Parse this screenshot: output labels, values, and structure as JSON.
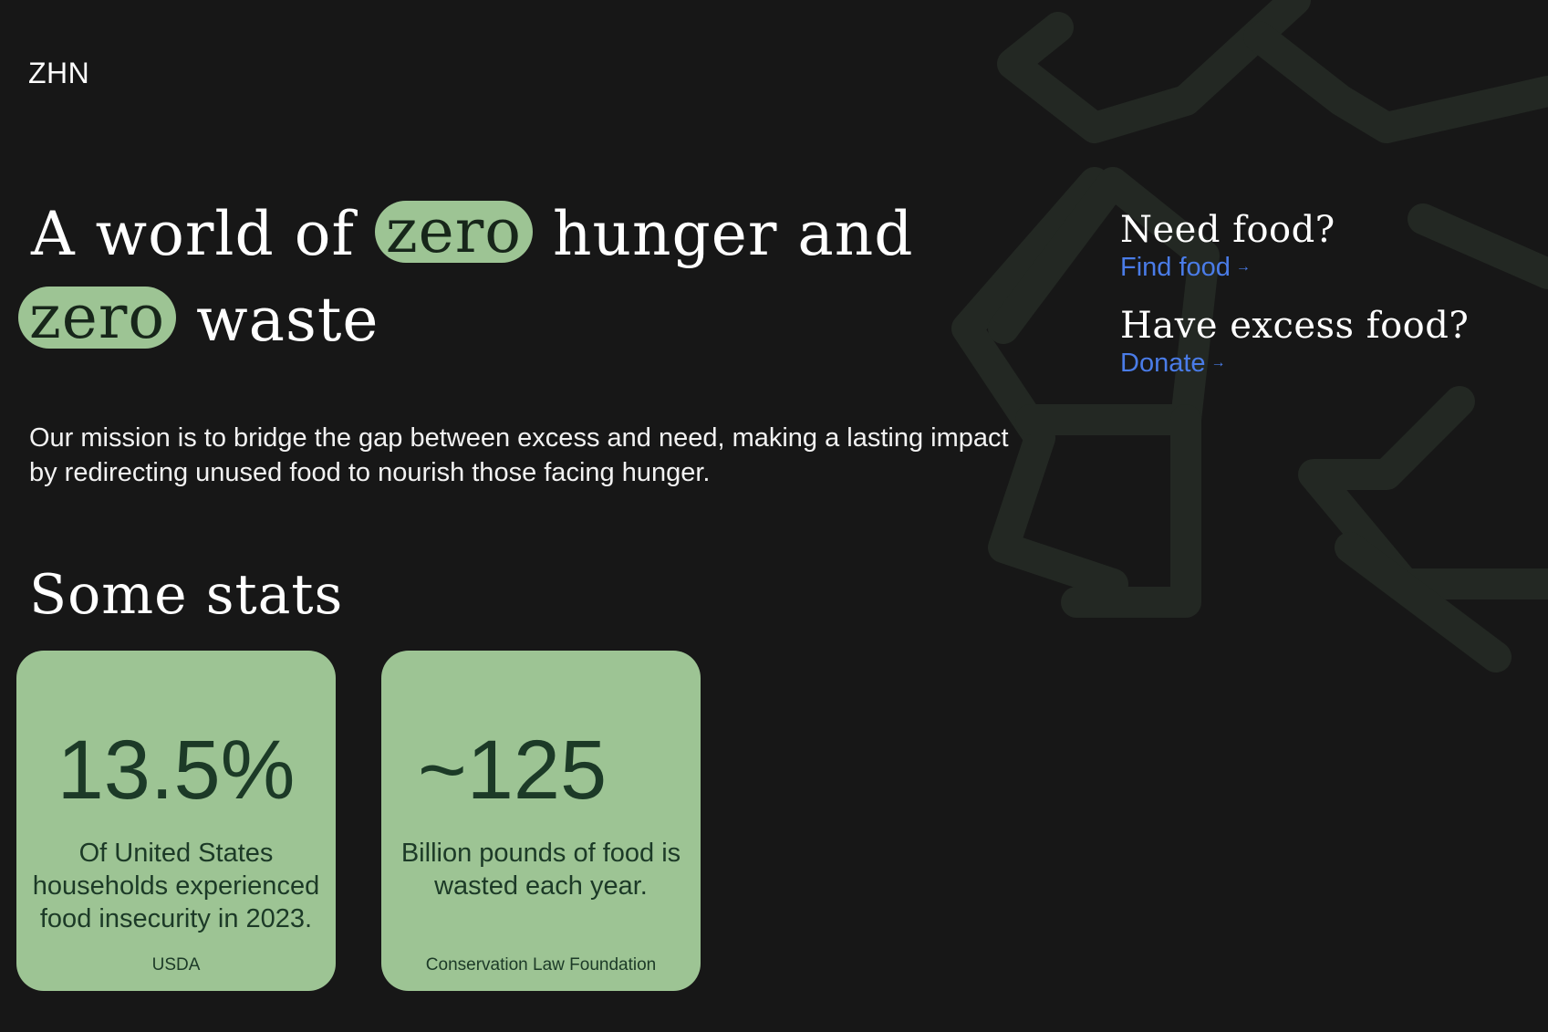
{
  "brand": {
    "logo": "ZHN"
  },
  "hero": {
    "pre": "A world of",
    "highlight1": "zero",
    "mid": "hunger and",
    "highlight2": "zero",
    "post": "waste"
  },
  "mission": "Our mission is to bridge the gap between excess and need, making a lasting impact by redirecting unused food to nourish those facing hunger.",
  "stats": {
    "title": "Some stats",
    "cards": [
      {
        "value": "13.5%",
        "description": "Of United States households experienced food insecurity in 2023.",
        "source": "USDA"
      },
      {
        "value": "~125",
        "description": "Billion pounds of food is wasted each year.",
        "source": "Conservation Law Foundation"
      }
    ]
  },
  "cta": {
    "need_food": {
      "heading": "Need food?",
      "link": "Find food",
      "arrow": "→"
    },
    "excess_food": {
      "heading": "Have excess food?",
      "link": "Donate",
      "arrow": "→"
    }
  },
  "colors": {
    "background": "#171717",
    "accent_green": "#9dc494",
    "dark_green_text": "#1c3a27",
    "link_blue": "#4a7ce8"
  },
  "icons": {
    "background_graphic": "recycle-icon"
  }
}
